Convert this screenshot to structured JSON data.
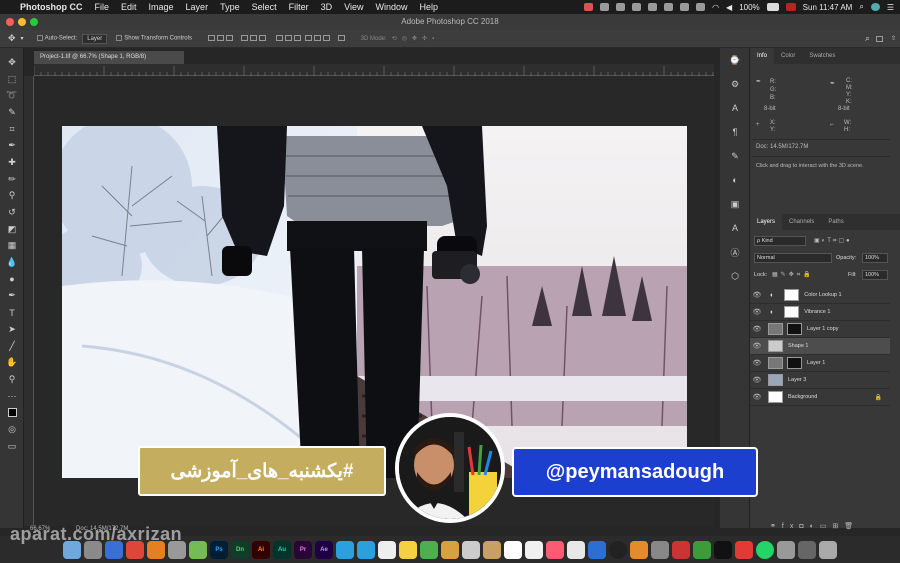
{
  "menubar": {
    "app_name": "Photoshop CC",
    "items": [
      "File",
      "Edit",
      "Image",
      "Layer",
      "Type",
      "Select",
      "Filter",
      "3D",
      "View",
      "Window",
      "Help"
    ],
    "battery": "100%",
    "clock": "Sun 11:47 AM"
  },
  "window": {
    "title": "Adobe Photoshop CC 2018"
  },
  "options": {
    "auto_select_label": "Auto-Select:",
    "auto_select_value": "Layer",
    "transform_label": "Show Transform Controls",
    "mode_3d_label": "3D Mode:"
  },
  "document": {
    "tab": "Project-1.tif @ 66.7% (Shape 1, RGB/8)",
    "zoom": "66.67%",
    "doc_size": "Doc: 14.5M/172.7M"
  },
  "panels": {
    "top_tabs": [
      "Info",
      "Color",
      "Swatches"
    ],
    "info": {
      "rgb_labels": "R:\nG:\nB:",
      "cmyk_labels": "C:\nM:\nY:\nK:",
      "bit_left": "8-bit",
      "bit_right": "8-bit",
      "xy_labels": "X:\nY:",
      "wh_labels": "W:\nH:",
      "doc": "Doc: 14.5M/172.7M",
      "hint": "Click and drag to interact with the 3D scene."
    },
    "layer_tabs": [
      "Layers",
      "Channels",
      "Paths"
    ],
    "kind": "ρ Kind",
    "blend_mode": "Normal",
    "opacity_label": "Opacity:",
    "opacity_value": "100%",
    "lock_label": "Lock:",
    "fill_label": "Fill:",
    "fill_value": "100%",
    "layers": [
      {
        "name": "Color Lookup 1"
      },
      {
        "name": "Vibrance 1"
      },
      {
        "name": "Layer 1 copy"
      },
      {
        "name": "Shape 1"
      },
      {
        "name": "Layer 1"
      },
      {
        "name": "Layer 3"
      },
      {
        "name": "Background"
      }
    ]
  },
  "overlay": {
    "watermark": "aparat.com/axrizan",
    "hashtag": "#یکشنبه_های_آموزشی",
    "handle": "@peymansadough"
  },
  "dock_apps": [
    "Ps",
    "Dn",
    "Ai",
    "Au",
    "Pr",
    "Ae"
  ],
  "colors": {
    "accent_blue": "#1d3fd0",
    "gold": "#c4ad5f"
  }
}
